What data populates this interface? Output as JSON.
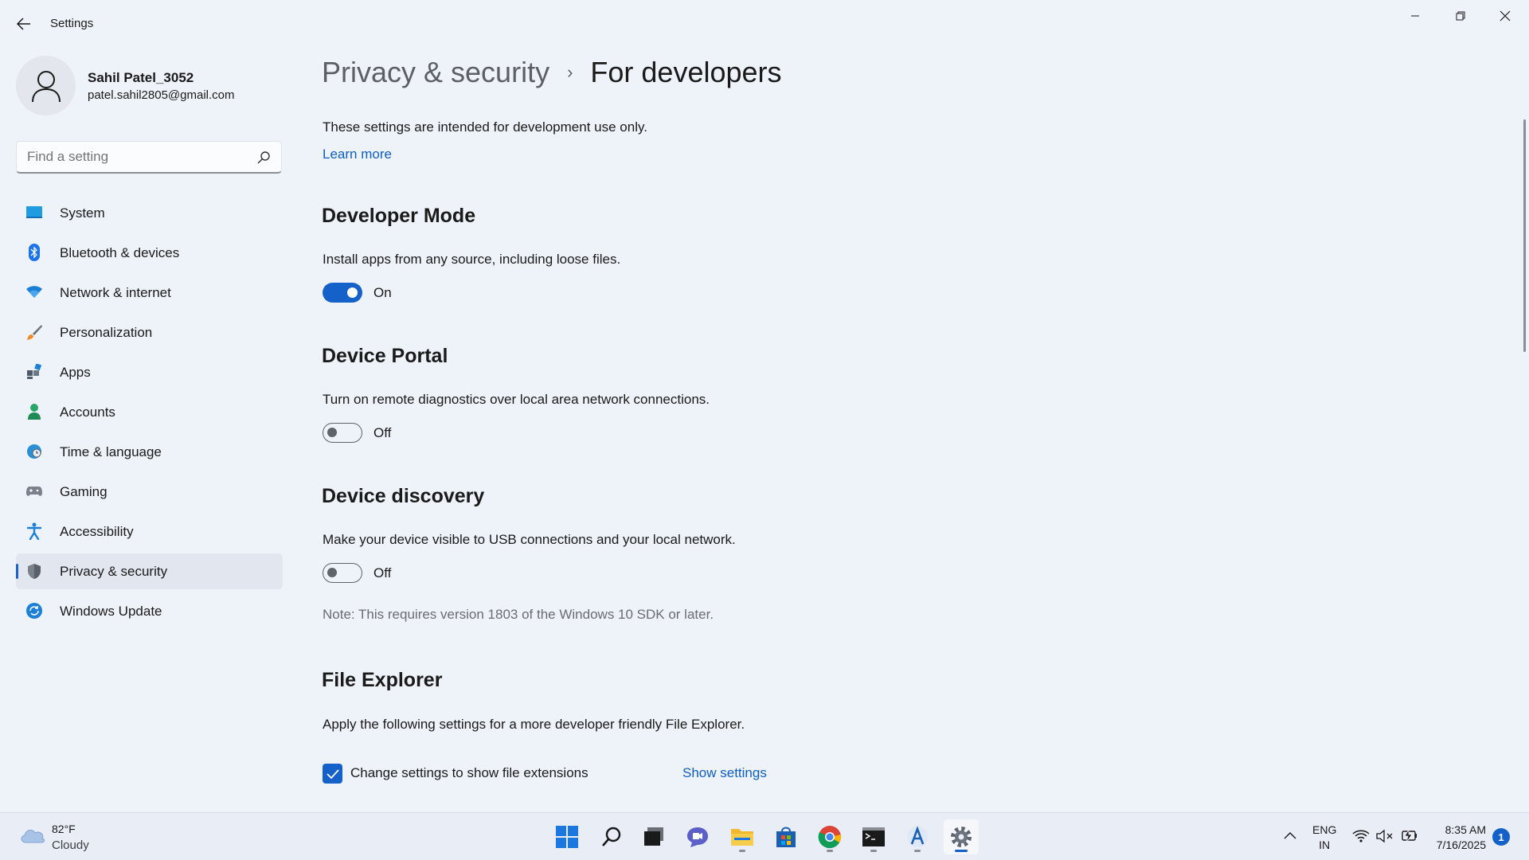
{
  "window": {
    "title": "Settings"
  },
  "profile": {
    "name": "Sahil Patel_3052",
    "email": "patel.sahil2805@gmail.com"
  },
  "search": {
    "placeholder": "Find a setting"
  },
  "sidebar": {
    "items": [
      {
        "label": "System",
        "icon": "system-icon"
      },
      {
        "label": "Bluetooth & devices",
        "icon": "bluetooth-icon"
      },
      {
        "label": "Network & internet",
        "icon": "wifi-icon"
      },
      {
        "label": "Personalization",
        "icon": "brush-icon"
      },
      {
        "label": "Apps",
        "icon": "apps-icon"
      },
      {
        "label": "Accounts",
        "icon": "accounts-icon"
      },
      {
        "label": "Time & language",
        "icon": "globe-clock-icon"
      },
      {
        "label": "Gaming",
        "icon": "gamepad-icon"
      },
      {
        "label": "Accessibility",
        "icon": "accessibility-icon"
      },
      {
        "label": "Privacy & security",
        "icon": "shield-icon",
        "active": true
      },
      {
        "label": "Windows Update",
        "icon": "update-icon"
      }
    ]
  },
  "breadcrumb": {
    "parent": "Privacy & security",
    "separator": "›",
    "current": "For developers"
  },
  "main": {
    "intro": "These settings are intended for development use only.",
    "learn_more": "Learn more",
    "developer_mode": {
      "title": "Developer Mode",
      "description": "Install apps from any source, including loose files.",
      "state": "On"
    },
    "device_portal": {
      "title": "Device Portal",
      "description": "Turn on remote diagnostics over local area network connections.",
      "state": "Off"
    },
    "device_discovery": {
      "title": "Device discovery",
      "description": "Make your device visible to USB connections and your local network.",
      "state": "Off",
      "note": "Note: This requires version 1803 of the Windows 10 SDK or later."
    },
    "file_explorer": {
      "title": "File Explorer",
      "description": "Apply the following settings for a more developer friendly File Explorer.",
      "checkbox_label": "Change settings to show file extensions",
      "checked": true,
      "show_settings": "Show settings"
    }
  },
  "taskbar": {
    "weather_temp": "82°F",
    "weather_condition": "Cloudy",
    "language_line1": "ENG",
    "language_line2": "IN",
    "time": "8:35 AM",
    "date": "7/16/2025",
    "notification_count": "1"
  },
  "colors": {
    "accent": "#1461c9",
    "background": "#eef2f9",
    "link": "#0f5fc0"
  }
}
